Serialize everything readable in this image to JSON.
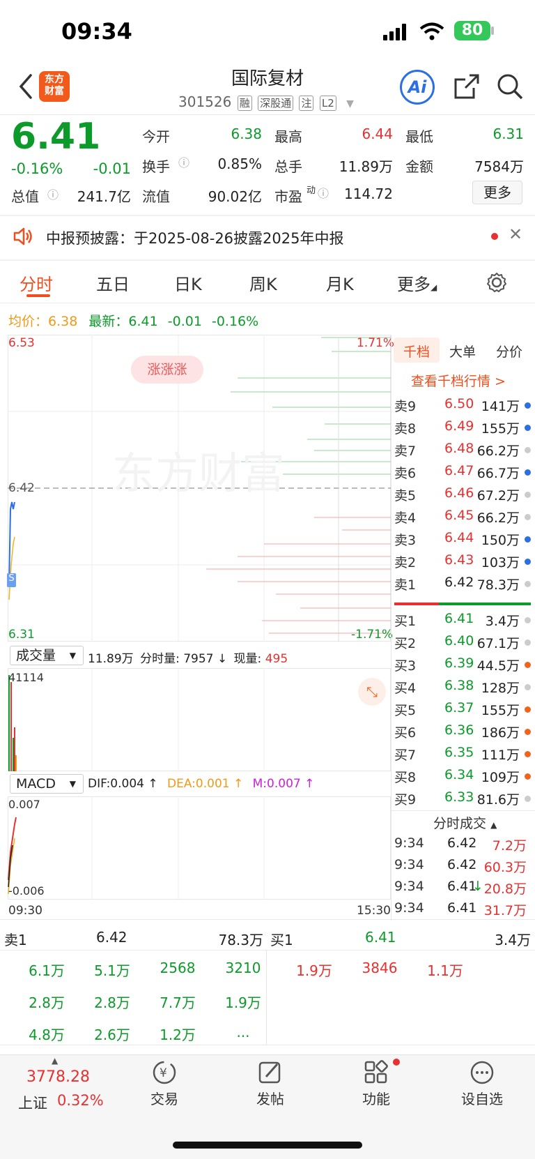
{
  "status_bar": {
    "time": "09:34",
    "battery": "80"
  },
  "header": {
    "logo_line1": "东方",
    "logo_line2": "财富",
    "stock_name": "国际复材",
    "stock_code": "301526",
    "tags": [
      "融",
      "深股通",
      "注",
      "L2"
    ],
    "ai_label": "Ai"
  },
  "quote": {
    "price": "6.41",
    "change_pct": "-0.16%",
    "change": "-0.01",
    "fields": {
      "open_label": "今开",
      "open": "6.38",
      "high_label": "最高",
      "high": "6.44",
      "low_label": "最低",
      "low": "6.31",
      "turnover_label": "换手",
      "turnover": "0.85%",
      "volume_label": "总手",
      "volume": "11.89万",
      "amount_label": "金额",
      "amount": "7584万",
      "mktcap_label": "总值",
      "mktcap": "241.7亿",
      "float_label": "流值",
      "float": "90.02亿",
      "pe_label": "市盈",
      "pe_sup": "动",
      "pe": "114.72"
    },
    "more_label": "更多"
  },
  "notice": {
    "text": "中报预披露：于2025-08-26披露2025年中报"
  },
  "tabs": [
    "分时",
    "五日",
    "日K",
    "周K",
    "月K",
    "更多"
  ],
  "intraday": {
    "avg_label": "均价：",
    "avg": "6.38",
    "latest_label": "最新：",
    "latest": "6.41",
    "chg": "-0.01",
    "chg_pct": "-0.16%",
    "price_high": "6.53",
    "price_mid": "6.42",
    "price_low": "6.31",
    "pct_high": "1.71%",
    "pct_low": "-1.71%",
    "watermark": "东方财富",
    "badge": "涨涨涨",
    "s_marker": "S"
  },
  "volume_panel": {
    "selector": "成交量",
    "total": "11.89万",
    "minute_label": "分时量:",
    "minute": "7957",
    "now_label": "现量:",
    "now": "495",
    "max": "41114"
  },
  "macd_panel": {
    "selector": "MACD",
    "dif": "DIF:0.004 ↑",
    "dea": "DEA:0.001 ↑",
    "m": "M:0.007 ↑",
    "top": "0.007",
    "bottom": "-0.006",
    "time_start": "09:30",
    "time_end": "15:30"
  },
  "right_panel": {
    "tabs": [
      "千档",
      "大单",
      "分价"
    ],
    "link": "查看千档行情 >",
    "asks": [
      {
        "label": "卖9",
        "price": "6.50",
        "vol": "141万",
        "dot": "#2b6fe3",
        "color": "red"
      },
      {
        "label": "卖8",
        "price": "6.49",
        "vol": "155万",
        "dot": "#2b6fe3",
        "color": "red"
      },
      {
        "label": "卖7",
        "price": "6.48",
        "vol": "66.2万",
        "dot": "#cccccc",
        "color": "red"
      },
      {
        "label": "卖6",
        "price": "6.47",
        "vol": "66.7万",
        "dot": "#2b6fe3",
        "color": "red"
      },
      {
        "label": "卖5",
        "price": "6.46",
        "vol": "67.2万",
        "dot": "#cccccc",
        "color": "red"
      },
      {
        "label": "卖4",
        "price": "6.45",
        "vol": "66.2万",
        "dot": "#cccccc",
        "color": "red"
      },
      {
        "label": "卖3",
        "price": "6.44",
        "vol": "150万",
        "dot": "#2b6fe3",
        "color": "red"
      },
      {
        "label": "卖2",
        "price": "6.43",
        "vol": "103万",
        "dot": "#2b6fe3",
        "color": "red"
      },
      {
        "label": "卖1",
        "price": "6.42",
        "vol": "78.3万",
        "dot": "#cccccc",
        "color": "dark"
      }
    ],
    "bids": [
      {
        "label": "买1",
        "price": "6.41",
        "vol": "3.4万",
        "dot": "#cccccc"
      },
      {
        "label": "买2",
        "price": "6.40",
        "vol": "67.1万",
        "dot": "#cccccc"
      },
      {
        "label": "买3",
        "price": "6.39",
        "vol": "44.5万",
        "dot": "#f0641e"
      },
      {
        "label": "买4",
        "price": "6.38",
        "vol": "128万",
        "dot": "#cccccc"
      },
      {
        "label": "买5",
        "price": "6.37",
        "vol": "155万",
        "dot": "#f0641e"
      },
      {
        "label": "买6",
        "price": "6.36",
        "vol": "186万",
        "dot": "#f0641e"
      },
      {
        "label": "买7",
        "price": "6.35",
        "vol": "111万",
        "dot": "#f0641e"
      },
      {
        "label": "买8",
        "price": "6.34",
        "vol": "109万",
        "dot": "#f0641e"
      },
      {
        "label": "买9",
        "price": "6.33",
        "vol": "81.6万",
        "dot": "#cccccc"
      }
    ],
    "trades_title": "分时成交",
    "trades": [
      {
        "time": "9:34",
        "price": "6.42",
        "vol": "7.2万",
        "arrow": ""
      },
      {
        "time": "9:34",
        "price": "6.42",
        "vol": "60.3万",
        "arrow": ""
      },
      {
        "time": "9:34",
        "price": "6.41",
        "vol": "20.8万",
        "arrow": "↓"
      },
      {
        "time": "9:34",
        "price": "6.41",
        "vol": "31.7万",
        "arrow": ""
      }
    ]
  },
  "order_queue": {
    "sell_label": "卖1",
    "sell_price": "6.42",
    "sell_vol": "78.3万",
    "buy_label": "买1",
    "buy_price": "6.41",
    "buy_vol": "3.4万",
    "sell_cells": [
      "6.1万",
      "5.1万",
      "2568",
      "3210",
      "2.8万",
      "2.8万",
      "7.7万",
      "1.9万",
      "4.8万",
      "2.6万",
      "1.2万",
      "..."
    ],
    "buy_cells": [
      "1.9万",
      "3846",
      "1.1万"
    ]
  },
  "bottom_nav": {
    "index_value": "3778.28",
    "index_name": "上证",
    "index_pct": "0.32%",
    "items": [
      "交易",
      "发帖",
      "功能",
      "设自选"
    ]
  }
}
